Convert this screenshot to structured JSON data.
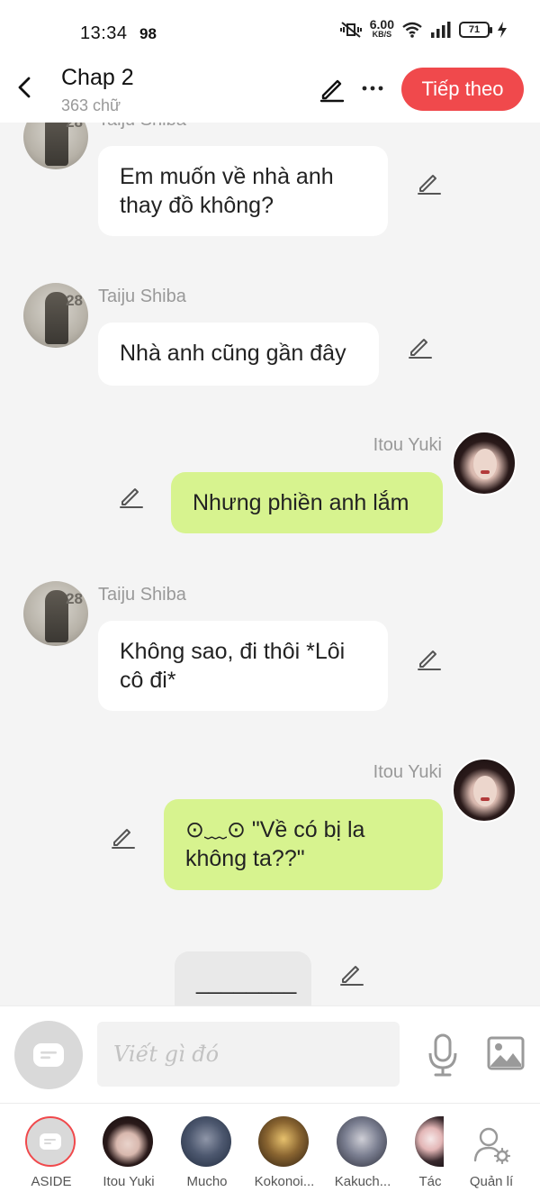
{
  "status_bar": {
    "time": "13:34",
    "badge": "98",
    "net_speed_value": "6.00",
    "net_speed_unit": "KB/S",
    "battery": "71"
  },
  "header": {
    "title": "Chap 2",
    "word_count": "363 chữ",
    "next_label": "Tiếp theo"
  },
  "messages": [
    {
      "side": "left",
      "sender": "Taiju Shiba",
      "text": "Em muốn về nhà anh thay đồ không?"
    },
    {
      "side": "left",
      "sender": "Taiju Shiba",
      "text": "Nhà anh cũng gần đây"
    },
    {
      "side": "right",
      "sender": "Itou Yuki",
      "text": "Nhưng phiền anh lắm"
    },
    {
      "side": "left",
      "sender": "Taiju Shiba",
      "text": "Không sao, đi thôi *Lôi cô đi*"
    },
    {
      "side": "right",
      "sender": "Itou Yuki",
      "text": "⊙﹏⊙ \"Về có bị la không ta??\""
    },
    {
      "side": "center",
      "sender": "",
      "text": "________"
    }
  ],
  "composer": {
    "placeholder": "Viết gì đó"
  },
  "characters": [
    {
      "label": "ASIDE"
    },
    {
      "label": "Itou Yuki"
    },
    {
      "label": "Mucho"
    },
    {
      "label": "Kokonoi..."
    },
    {
      "label": "Kakuch..."
    },
    {
      "label": "Tác"
    },
    {
      "label": "Quản lí"
    }
  ],
  "colors": {
    "accent": "#f0494c",
    "right_bubble": "#d7f38f",
    "left_bubble": "#ffffff",
    "background": "#f4f4f4"
  }
}
